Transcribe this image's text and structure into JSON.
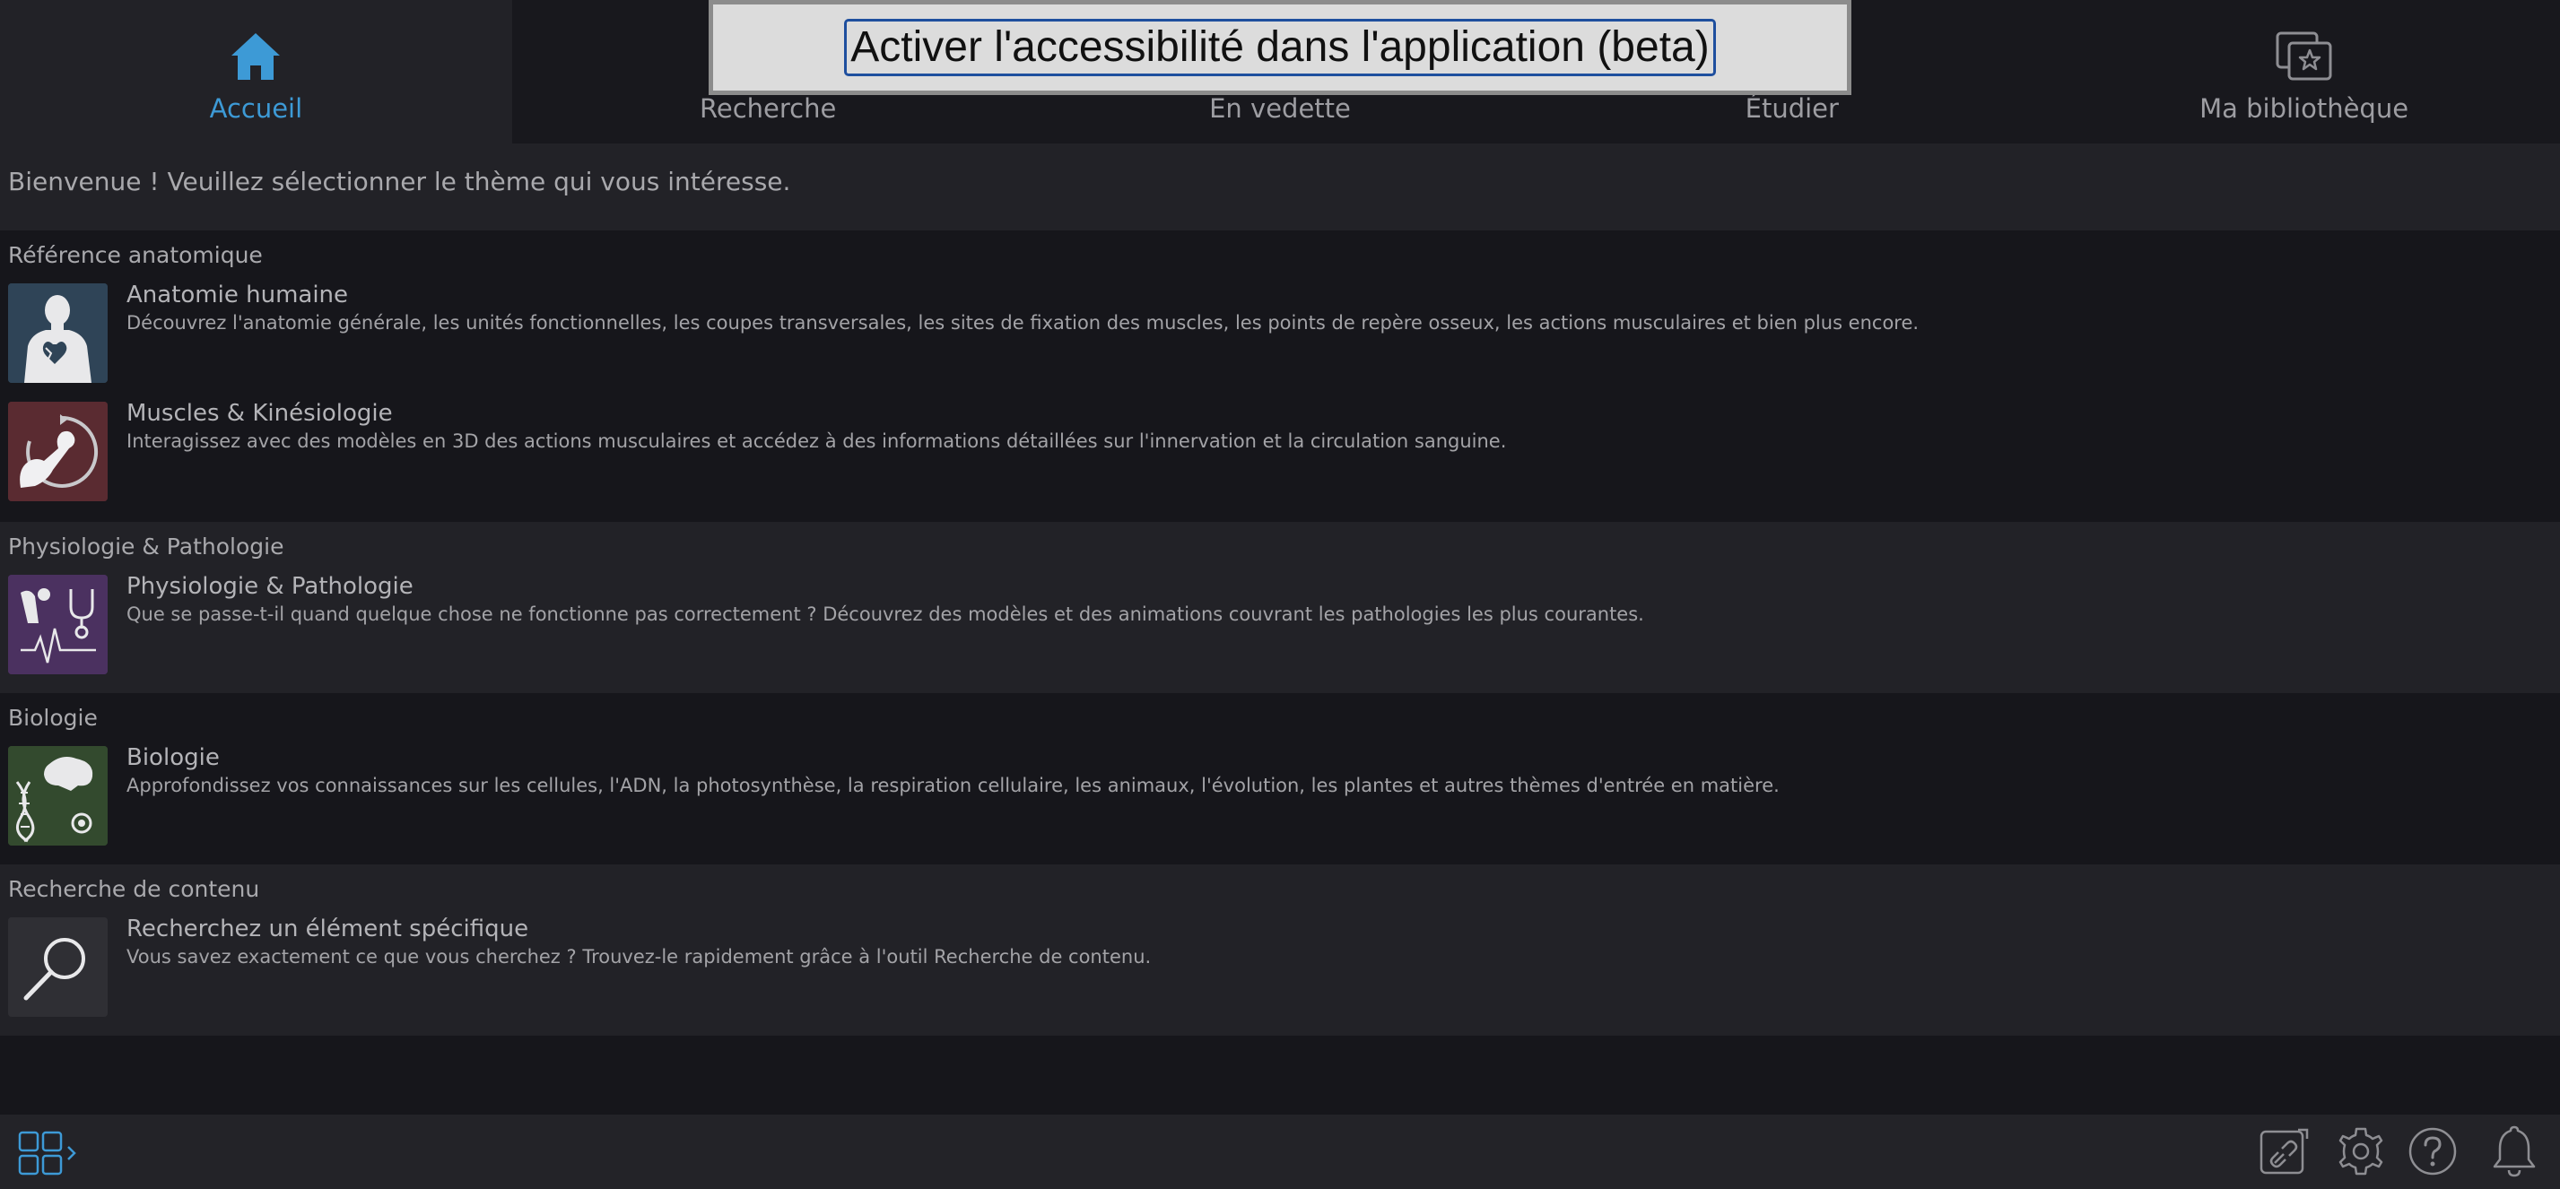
{
  "accessibility_banner": {
    "label": "Activer l'accessibilité dans l'application (beta)"
  },
  "nav": {
    "tabs": [
      {
        "label": "Accueil",
        "icon": "home-icon",
        "active": true
      },
      {
        "label": "Recherche",
        "icon": "search-icon",
        "active": false
      },
      {
        "label": "En vedette",
        "icon": "featured-icon",
        "active": false
      },
      {
        "label": "Étudier",
        "icon": "study-icon",
        "active": false
      },
      {
        "label": "Ma bibliothèque",
        "icon": "library-icon",
        "active": false
      }
    ]
  },
  "welcome": {
    "text": "Bienvenue ! Veuillez sélectionner le thème qui vous intéresse."
  },
  "sections": [
    {
      "title": "Référence anatomique",
      "items": [
        {
          "title": "Anatomie humaine",
          "description": "Découvrez l'anatomie générale, les unités fonctionnelles, les coupes transversales, les sites de fixation des muscles, les points de repère osseux, les actions musculaires et bien plus encore."
        },
        {
          "title": "Muscles & Kinésiologie",
          "description": "Interagissez avec des modèles en 3D des actions musculaires et accédez à des informations détaillées sur l'innervation et la circulation sanguine."
        }
      ]
    },
    {
      "title": "Physiologie & Pathologie",
      "items": [
        {
          "title": "Physiologie & Pathologie",
          "description": "Que se passe-t-il quand quelque chose ne fonctionne pas correctement ? Découvrez des modèles et des animations couvrant les pathologies les plus courantes."
        }
      ]
    },
    {
      "title": "Biologie",
      "items": [
        {
          "title": "Biologie",
          "description": "Approfondissez vos connaissances sur les cellules, l'ADN, la photosynthèse, la respiration cellulaire, les animaux, l'évolution, les plantes et autres thèmes d'entrée en matière."
        }
      ]
    },
    {
      "title": "Recherche de contenu",
      "items": [
        {
          "title": "Recherchez un élément spécifique",
          "description": "Vous savez exactement ce que vous cherchez ? Trouvez-le rapidement grâce à l'outil Recherche de contenu."
        }
      ]
    }
  ],
  "bottombar": {
    "icons": [
      "app-switcher-icon",
      "link-icon",
      "gear-icon",
      "help-icon",
      "bell-icon"
    ]
  },
  "colors": {
    "accent": "#3d9ad6",
    "background": "#16161b",
    "band": "#222227",
    "anatomy_thumb": "#2f4457",
    "muscles_thumb": "#5a2b31",
    "physio_thumb": "#4b3160",
    "biology_thumb": "#334a2e",
    "search_thumb": "#2f2f34"
  }
}
